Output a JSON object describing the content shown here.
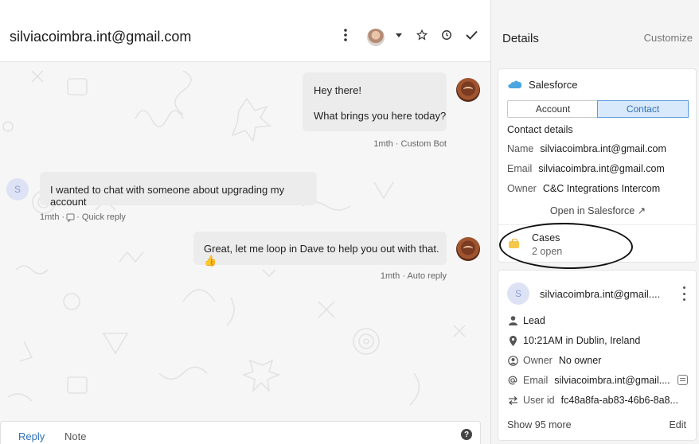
{
  "conversation": {
    "title": "silviacoimbra.int@gmail.com",
    "header_icons": [
      "more-vertical-icon",
      "assignee-avatar",
      "chevron-down-icon",
      "star-icon",
      "snooze-clock-icon",
      "close-check-icon"
    ],
    "messages": [
      {
        "side": "right",
        "lines": [
          "Hey there!",
          "What brings you here today?"
        ],
        "meta": "1mth · Custom Bot"
      },
      {
        "side": "left",
        "avatar": "S",
        "text": "I wanted to chat with someone about upgrading my account",
        "meta": "1mth · ",
        "meta_tail": " · Quick reply"
      },
      {
        "side": "right",
        "text": "Great, let me loop in Dave to help you out with that. 👍",
        "meta": "1mth · Auto reply"
      }
    ],
    "composer": {
      "reply_tab": "Reply",
      "note_tab": "Note",
      "help_icon": "?"
    },
    "colors": {
      "accent": "#2f6fb6",
      "bubble": "#ececec"
    }
  },
  "details": {
    "title": "Details",
    "customize": "Customize",
    "salesforce": {
      "title": "Salesforce",
      "tabs": [
        "Account",
        "Contact"
      ],
      "active_tab": "Contact",
      "contact_details_title": "Contact details",
      "fields": [
        {
          "key": "Name",
          "value": "silviacoimbra.int@gmail.com"
        },
        {
          "key": "Email",
          "value": "silviacoimbra.int@gmail.com"
        },
        {
          "key": "Owner",
          "value": "C&C Integrations Intercom"
        }
      ],
      "open_link": "Open in Salesforce ↗",
      "cases": {
        "title": "Cases",
        "count": "2 open"
      }
    },
    "user": {
      "avatar": "S",
      "name": "silviacoimbra.int@gmail....",
      "attributes": [
        {
          "icon": "person-icon",
          "key": "",
          "value": "Lead"
        },
        {
          "icon": "location-pin-icon",
          "key": "",
          "value": "10:21AM in Dublin, Ireland"
        },
        {
          "icon": "owner-icon",
          "key": "Owner",
          "value": "No owner"
        },
        {
          "icon": "at-icon",
          "key": "Email",
          "value": "silviacoimbra.int@gmail...."
        },
        {
          "icon": "swap-arrows-icon",
          "key": "User id",
          "value": "fc48a8fa-ab83-46b6-8a8..."
        }
      ],
      "show_more": "Show 95 more",
      "edit": "Edit"
    }
  }
}
